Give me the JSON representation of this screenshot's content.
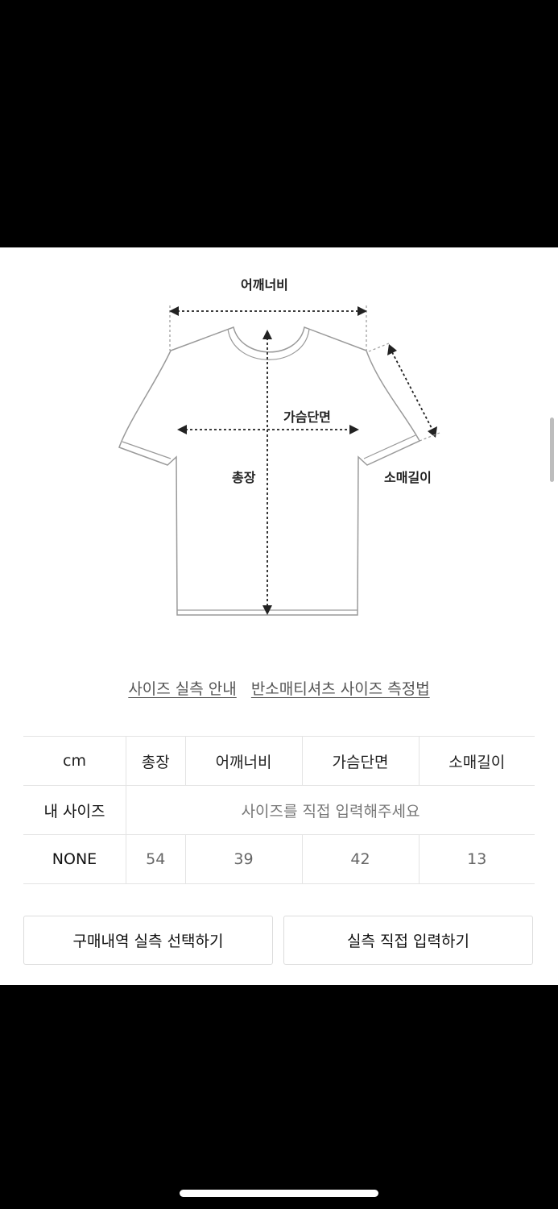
{
  "diagram": {
    "shoulder_label": "어깨너비",
    "chest_label": "가슴단면",
    "length_label": "총장",
    "sleeve_label": "소매길이"
  },
  "links": {
    "size_guide": "사이즈 실측 안내",
    "measure_method": "반소매티셔츠 사이즈 측정법"
  },
  "table": {
    "headers": [
      "cm",
      "총장",
      "어깨너비",
      "가슴단면",
      "소매길이"
    ],
    "my_size": {
      "label": "내 사이즈",
      "placeholder": "사이즈를 직접 입력해주세요"
    },
    "rows": [
      {
        "label": "NONE",
        "values": [
          "54",
          "39",
          "42",
          "13"
        ]
      }
    ]
  },
  "buttons": {
    "select_from_purchase": "구매내역 실측 선택하기",
    "direct_input": "실측 직접 입력하기"
  }
}
